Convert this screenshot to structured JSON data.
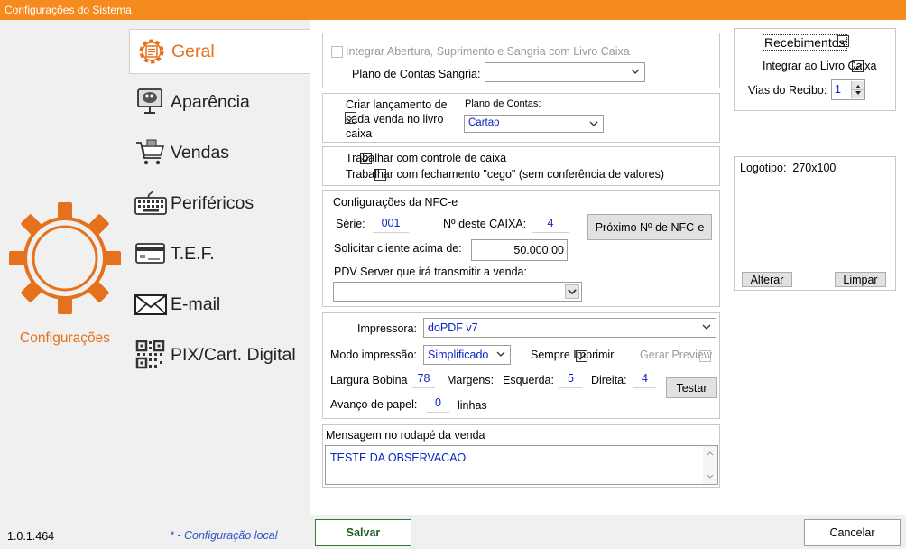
{
  "window": {
    "title": "Configurações do Sistema"
  },
  "sidebar": {
    "items": [
      {
        "label": "Geral",
        "icon": "gear-doc-icon"
      },
      {
        "label": "Aparência",
        "icon": "monitor-palette-icon"
      },
      {
        "label": "Vendas",
        "icon": "shopping-cart-icon"
      },
      {
        "label": "Periféricos",
        "icon": "keyboard-icon"
      },
      {
        "label": "T.E.F.",
        "icon": "credit-card-icon"
      },
      {
        "label": "E-mail",
        "icon": "envelope-icon"
      },
      {
        "label": "PIX/Cart. Digital",
        "icon": "qr-code-icon"
      }
    ],
    "section_label": "Configurações",
    "accent": "#e5711c"
  },
  "caixa_group": {
    "integrar_label": "Integrar Abertura, Suprimento e Sangria com Livro Caixa",
    "plano_sangria_label": "Plano de Contas Sangria:",
    "plano_sangria_value": ""
  },
  "lancamento_group": {
    "criar_label_1": "Criar lançamento de",
    "criar_label_2": "cada venda no livro",
    "criar_label_3": "caixa",
    "plano_label": "Plano de Contas:",
    "plano_value": "Cartao"
  },
  "controle_group": {
    "controle_label": "Trabalhar com controle de caixa",
    "cego_label": "Trabalhar com fechamento \"cego\" (sem conferência de valores)"
  },
  "nfce_group": {
    "title": "Configurações da NFC-e",
    "serie_label": "Série:",
    "serie_value": "001",
    "caixa_label": "Nº deste CAIXA:",
    "caixa_value": "4",
    "proximo_button": "Próximo Nº de NFC-e",
    "solicitar_label": "Solicitar cliente acima de:",
    "solicitar_value": "50.000,00",
    "pdv_label": "PDV Server que irá transmitir a venda:",
    "pdv_value": ""
  },
  "impressao_group": {
    "impressora_label": "Impressora:",
    "impressora_value": "doPDF v7",
    "modo_label": "Modo impressão:",
    "modo_value": "Simplificado",
    "sempre_label": "Sempre Imprimir",
    "preview_label": "Gerar Preview",
    "largura_label": "Largura Bobina",
    "largura_value": "78",
    "margens_label": "Margens:",
    "esquerda_label": "Esquerda:",
    "esquerda_value": "5",
    "direita_label": "Direita:",
    "direita_value": "4",
    "testar_button": "Testar",
    "avanco_label": "Avanço de papel:",
    "avanco_value": "0",
    "linhas_label": "linhas"
  },
  "mensagem_group": {
    "title": "Mensagem no rodapé da venda",
    "value": "TESTE DA OBSERVACAO"
  },
  "recebimentos_group": {
    "recebimentos_label": "Recebimentos",
    "integrar_label": "Integrar ao Livro Caixa",
    "vias_label": "Vias do Recibo:",
    "vias_value": "1"
  },
  "logo_group": {
    "label": "Logotipo:  270x100",
    "alterar_button": "Alterar",
    "limpar_button": "Limpar"
  },
  "footer": {
    "version": "1.0.1.464",
    "note": "* - Configuração local",
    "save_button": "Salvar",
    "cancel_button": "Cancelar"
  }
}
